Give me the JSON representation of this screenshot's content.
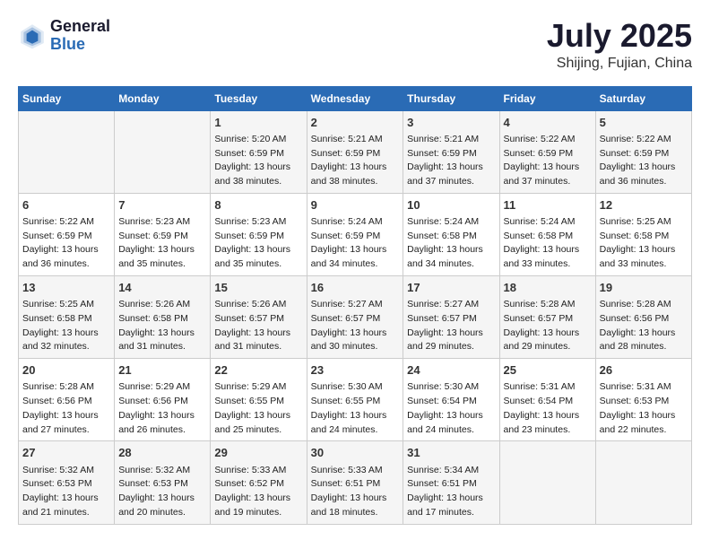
{
  "header": {
    "logo_general": "General",
    "logo_blue": "Blue",
    "month_year": "July 2025",
    "location": "Shijing, Fujian, China"
  },
  "weekdays": [
    "Sunday",
    "Monday",
    "Tuesday",
    "Wednesday",
    "Thursday",
    "Friday",
    "Saturday"
  ],
  "weeks": [
    [
      {
        "day": "",
        "sunrise": "",
        "sunset": "",
        "daylight": ""
      },
      {
        "day": "",
        "sunrise": "",
        "sunset": "",
        "daylight": ""
      },
      {
        "day": "1",
        "sunrise": "Sunrise: 5:20 AM",
        "sunset": "Sunset: 6:59 PM",
        "daylight": "Daylight: 13 hours and 38 minutes."
      },
      {
        "day": "2",
        "sunrise": "Sunrise: 5:21 AM",
        "sunset": "Sunset: 6:59 PM",
        "daylight": "Daylight: 13 hours and 38 minutes."
      },
      {
        "day": "3",
        "sunrise": "Sunrise: 5:21 AM",
        "sunset": "Sunset: 6:59 PM",
        "daylight": "Daylight: 13 hours and 37 minutes."
      },
      {
        "day": "4",
        "sunrise": "Sunrise: 5:22 AM",
        "sunset": "Sunset: 6:59 PM",
        "daylight": "Daylight: 13 hours and 37 minutes."
      },
      {
        "day": "5",
        "sunrise": "Sunrise: 5:22 AM",
        "sunset": "Sunset: 6:59 PM",
        "daylight": "Daylight: 13 hours and 36 minutes."
      }
    ],
    [
      {
        "day": "6",
        "sunrise": "Sunrise: 5:22 AM",
        "sunset": "Sunset: 6:59 PM",
        "daylight": "Daylight: 13 hours and 36 minutes."
      },
      {
        "day": "7",
        "sunrise": "Sunrise: 5:23 AM",
        "sunset": "Sunset: 6:59 PM",
        "daylight": "Daylight: 13 hours and 35 minutes."
      },
      {
        "day": "8",
        "sunrise": "Sunrise: 5:23 AM",
        "sunset": "Sunset: 6:59 PM",
        "daylight": "Daylight: 13 hours and 35 minutes."
      },
      {
        "day": "9",
        "sunrise": "Sunrise: 5:24 AM",
        "sunset": "Sunset: 6:59 PM",
        "daylight": "Daylight: 13 hours and 34 minutes."
      },
      {
        "day": "10",
        "sunrise": "Sunrise: 5:24 AM",
        "sunset": "Sunset: 6:58 PM",
        "daylight": "Daylight: 13 hours and 34 minutes."
      },
      {
        "day": "11",
        "sunrise": "Sunrise: 5:24 AM",
        "sunset": "Sunset: 6:58 PM",
        "daylight": "Daylight: 13 hours and 33 minutes."
      },
      {
        "day": "12",
        "sunrise": "Sunrise: 5:25 AM",
        "sunset": "Sunset: 6:58 PM",
        "daylight": "Daylight: 13 hours and 33 minutes."
      }
    ],
    [
      {
        "day": "13",
        "sunrise": "Sunrise: 5:25 AM",
        "sunset": "Sunset: 6:58 PM",
        "daylight": "Daylight: 13 hours and 32 minutes."
      },
      {
        "day": "14",
        "sunrise": "Sunrise: 5:26 AM",
        "sunset": "Sunset: 6:58 PM",
        "daylight": "Daylight: 13 hours and 31 minutes."
      },
      {
        "day": "15",
        "sunrise": "Sunrise: 5:26 AM",
        "sunset": "Sunset: 6:57 PM",
        "daylight": "Daylight: 13 hours and 31 minutes."
      },
      {
        "day": "16",
        "sunrise": "Sunrise: 5:27 AM",
        "sunset": "Sunset: 6:57 PM",
        "daylight": "Daylight: 13 hours and 30 minutes."
      },
      {
        "day": "17",
        "sunrise": "Sunrise: 5:27 AM",
        "sunset": "Sunset: 6:57 PM",
        "daylight": "Daylight: 13 hours and 29 minutes."
      },
      {
        "day": "18",
        "sunrise": "Sunrise: 5:28 AM",
        "sunset": "Sunset: 6:57 PM",
        "daylight": "Daylight: 13 hours and 29 minutes."
      },
      {
        "day": "19",
        "sunrise": "Sunrise: 5:28 AM",
        "sunset": "Sunset: 6:56 PM",
        "daylight": "Daylight: 13 hours and 28 minutes."
      }
    ],
    [
      {
        "day": "20",
        "sunrise": "Sunrise: 5:28 AM",
        "sunset": "Sunset: 6:56 PM",
        "daylight": "Daylight: 13 hours and 27 minutes."
      },
      {
        "day": "21",
        "sunrise": "Sunrise: 5:29 AM",
        "sunset": "Sunset: 6:56 PM",
        "daylight": "Daylight: 13 hours and 26 minutes."
      },
      {
        "day": "22",
        "sunrise": "Sunrise: 5:29 AM",
        "sunset": "Sunset: 6:55 PM",
        "daylight": "Daylight: 13 hours and 25 minutes."
      },
      {
        "day": "23",
        "sunrise": "Sunrise: 5:30 AM",
        "sunset": "Sunset: 6:55 PM",
        "daylight": "Daylight: 13 hours and 24 minutes."
      },
      {
        "day": "24",
        "sunrise": "Sunrise: 5:30 AM",
        "sunset": "Sunset: 6:54 PM",
        "daylight": "Daylight: 13 hours and 24 minutes."
      },
      {
        "day": "25",
        "sunrise": "Sunrise: 5:31 AM",
        "sunset": "Sunset: 6:54 PM",
        "daylight": "Daylight: 13 hours and 23 minutes."
      },
      {
        "day": "26",
        "sunrise": "Sunrise: 5:31 AM",
        "sunset": "Sunset: 6:53 PM",
        "daylight": "Daylight: 13 hours and 22 minutes."
      }
    ],
    [
      {
        "day": "27",
        "sunrise": "Sunrise: 5:32 AM",
        "sunset": "Sunset: 6:53 PM",
        "daylight": "Daylight: 13 hours and 21 minutes."
      },
      {
        "day": "28",
        "sunrise": "Sunrise: 5:32 AM",
        "sunset": "Sunset: 6:53 PM",
        "daylight": "Daylight: 13 hours and 20 minutes."
      },
      {
        "day": "29",
        "sunrise": "Sunrise: 5:33 AM",
        "sunset": "Sunset: 6:52 PM",
        "daylight": "Daylight: 13 hours and 19 minutes."
      },
      {
        "day": "30",
        "sunrise": "Sunrise: 5:33 AM",
        "sunset": "Sunset: 6:51 PM",
        "daylight": "Daylight: 13 hours and 18 minutes."
      },
      {
        "day": "31",
        "sunrise": "Sunrise: 5:34 AM",
        "sunset": "Sunset: 6:51 PM",
        "daylight": "Daylight: 13 hours and 17 minutes."
      },
      {
        "day": "",
        "sunrise": "",
        "sunset": "",
        "daylight": ""
      },
      {
        "day": "",
        "sunrise": "",
        "sunset": "",
        "daylight": ""
      }
    ]
  ]
}
